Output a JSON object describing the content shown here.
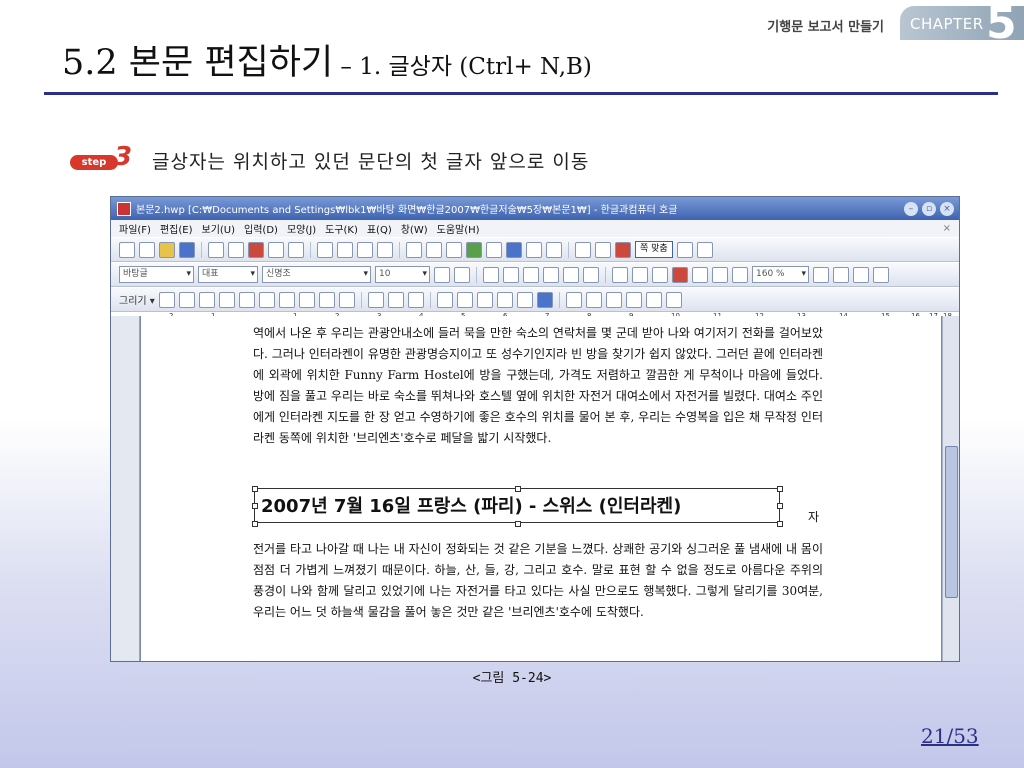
{
  "header": {
    "chapter_label": "기행문 보고서 만들기",
    "chapter_word": "CHAPTER",
    "chapter_number": "5"
  },
  "title": {
    "main": "5.2 본문 편집하기",
    "dash": " – ",
    "sub": "1. 글상자 (Ctrl+ N,B)"
  },
  "step": {
    "badge": "step",
    "number": "3",
    "text": "글상자는 위치하고 있던 문단의 첫 글자 앞으로 이동"
  },
  "window": {
    "title": "본문2.hwp [C:₩Documents and Settings₩lbk1₩바탕 화면₩한글2007₩한글저술₩5장₩본문1₩] - 한글과컴퓨터 호글",
    "menu": [
      "파일(F)",
      "편집(E)",
      "보기(U)",
      "입력(D)",
      "모양(J)",
      "도구(K)",
      "표(Q)",
      "창(W)",
      "도움말(H)"
    ],
    "zoom": "쪽 맞춤",
    "style_combo": "바탕글",
    "font_type_combo": "대표",
    "font_combo": "신명조",
    "size_combo": "10",
    "line_spacing": "160 %"
  },
  "ruler_ticks": [
    "2",
    "1",
    "1",
    "2",
    "3",
    "4",
    "5",
    "6",
    "7",
    "8",
    "9",
    "10",
    "11",
    "12",
    "13",
    "14",
    "15",
    "16",
    "17",
    "18"
  ],
  "document": {
    "paragraph1": "역에서 나온 후 우리는 관광안내소에 들러 묵을 만한 숙소의 연락처를 몇 군데 받아 나와 여기저기 전화를 걸어보았다. 그러나 인터라켄이 유명한 관광명승지이고 또 성수기인지라 빈 방을 찾기가 쉽지 않았다. 그러던 끝에 인터라켄에 외곽에 위치한 Funny Farm Hostel에 방을 구했는데, 가격도 저렴하고 깔끔한 게 무척이나 마음에 들었다. 방에 짐을 풀고 우리는 바로 숙소를 뛰쳐나와 호스텔 옆에 위치한 자전거 대여소에서 자전거를 빌렸다. 대여소 주인에게 인터라켄 지도를 한 장 얻고 수영하기에 좋은 호수의 위치를 물어 본 후, 우리는 수영복을 입은 채 무작정 인터라켄 동쪽에 위치한 '브리엔츠'호수로 페달을 밟기 시작했다.",
    "heading": "2007년 7월 16일 프랑스 (파리) - 스위스 (인터라켄)",
    "side_char": "자",
    "paragraph2": "전거를 타고 나아갈 때 나는 내 자신이 정화되는 것 같은 기분을 느꼈다. 상쾌한 공기와 싱그러운 풀 냄새에 내 몸이 점점 더 가볍게 느껴졌기 때문이다. 하늘, 산, 들, 강, 그리고 호수. 말로 표현 할 수 없을 정도로 아름다운 주위의 풍경이 나와 함께 달리고 있었기에 나는 자전거를 타고 있다는 사실 만으로도 행복했다. 그렇게 달리기를 30여분, 우리는 어느 덧 하늘색 물감을 풀어 놓은 것만 같은 '브리엔츠'호수에 도착했다."
  },
  "caption": "<그림 5-24>",
  "page_number": "21/53"
}
